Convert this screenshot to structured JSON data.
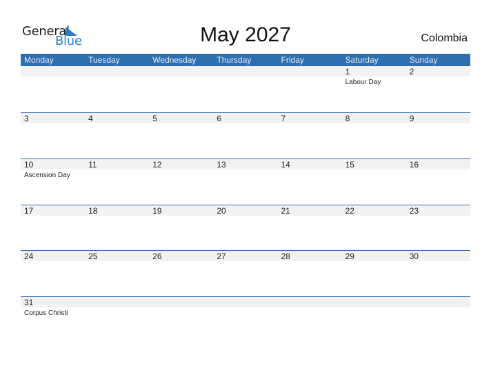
{
  "brand": {
    "general": "General",
    "blue": "Blue"
  },
  "title": "May 2027",
  "country": "Colombia",
  "colors": {
    "header": "#2e6fb0",
    "brand_blue": "#2a7dc7",
    "day_bg": "#f2f2f2"
  },
  "weekdays": [
    "Monday",
    "Tuesday",
    "Wednesday",
    "Thursday",
    "Friday",
    "Saturday",
    "Sunday"
  ],
  "weeks": [
    [
      {
        "d": "",
        "e": ""
      },
      {
        "d": "",
        "e": ""
      },
      {
        "d": "",
        "e": ""
      },
      {
        "d": "",
        "e": ""
      },
      {
        "d": "",
        "e": ""
      },
      {
        "d": "1",
        "e": "Labour Day"
      },
      {
        "d": "2",
        "e": ""
      }
    ],
    [
      {
        "d": "3",
        "e": ""
      },
      {
        "d": "4",
        "e": ""
      },
      {
        "d": "5",
        "e": ""
      },
      {
        "d": "6",
        "e": ""
      },
      {
        "d": "7",
        "e": ""
      },
      {
        "d": "8",
        "e": ""
      },
      {
        "d": "9",
        "e": ""
      }
    ],
    [
      {
        "d": "10",
        "e": "Ascension Day"
      },
      {
        "d": "11",
        "e": ""
      },
      {
        "d": "12",
        "e": ""
      },
      {
        "d": "13",
        "e": ""
      },
      {
        "d": "14",
        "e": ""
      },
      {
        "d": "15",
        "e": ""
      },
      {
        "d": "16",
        "e": ""
      }
    ],
    [
      {
        "d": "17",
        "e": ""
      },
      {
        "d": "18",
        "e": ""
      },
      {
        "d": "19",
        "e": ""
      },
      {
        "d": "20",
        "e": ""
      },
      {
        "d": "21",
        "e": ""
      },
      {
        "d": "22",
        "e": ""
      },
      {
        "d": "23",
        "e": ""
      }
    ],
    [
      {
        "d": "24",
        "e": ""
      },
      {
        "d": "25",
        "e": ""
      },
      {
        "d": "26",
        "e": ""
      },
      {
        "d": "27",
        "e": ""
      },
      {
        "d": "28",
        "e": ""
      },
      {
        "d": "29",
        "e": ""
      },
      {
        "d": "30",
        "e": ""
      }
    ],
    [
      {
        "d": "31",
        "e": "Corpus Christi"
      },
      {
        "d": "",
        "e": ""
      },
      {
        "d": "",
        "e": ""
      },
      {
        "d": "",
        "e": ""
      },
      {
        "d": "",
        "e": ""
      },
      {
        "d": "",
        "e": ""
      },
      {
        "d": "",
        "e": ""
      }
    ]
  ]
}
